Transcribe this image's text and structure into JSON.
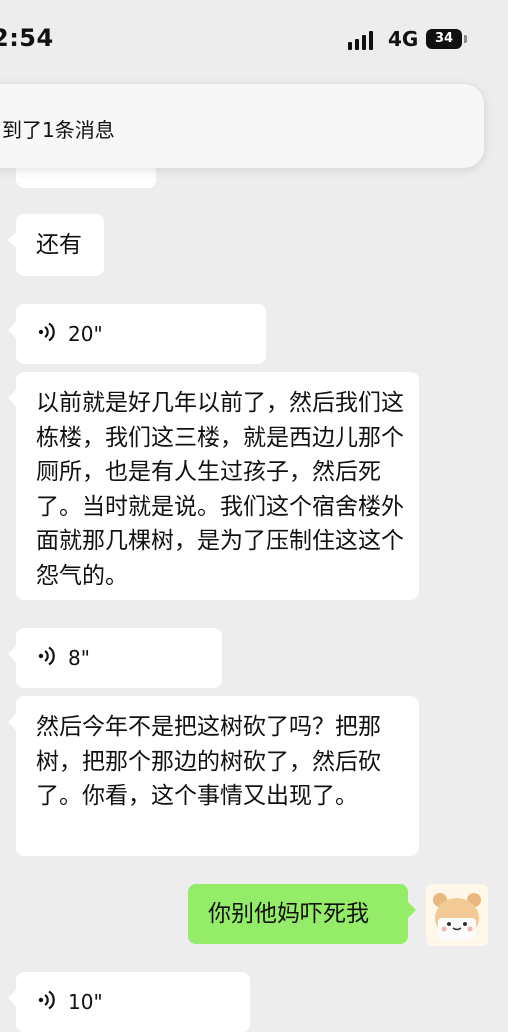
{
  "status_bar": {
    "time": "2:54",
    "network": "4G",
    "battery": "34"
  },
  "notification": {
    "text": "到了1条消息"
  },
  "messages": [
    {
      "sender": "other",
      "type": "text",
      "text": "还有"
    },
    {
      "sender": "other",
      "type": "voice",
      "duration": "20\"",
      "icon": "voice-wave-icon"
    },
    {
      "sender": "other",
      "type": "text",
      "text": "以前就是好几年以前了，然后我们这栋楼，我们这三楼，就是西边儿那个厕所，也是有人生过孩子，然后死了。当时就是说。我们这个宿舍楼外面就那几棵树，是为了压制住这这个怨气的。"
    },
    {
      "sender": "other",
      "type": "voice",
      "duration": "8\"",
      "icon": "voice-wave-icon"
    },
    {
      "sender": "other",
      "type": "text",
      "text": "然后今年不是把这树砍了吗？把那树，把那个那边的树砍了，然后砍了。你看，这个事情又出现了。"
    },
    {
      "sender": "self",
      "type": "text",
      "text": "你别他妈吓死我"
    },
    {
      "sender": "other",
      "type": "voice",
      "duration": "10\"",
      "icon": "voice-wave-icon"
    }
  ],
  "colors": {
    "chat_background": "#ededed",
    "incoming_bubble": "#ffffff",
    "outgoing_bubble": "#95ec69"
  }
}
